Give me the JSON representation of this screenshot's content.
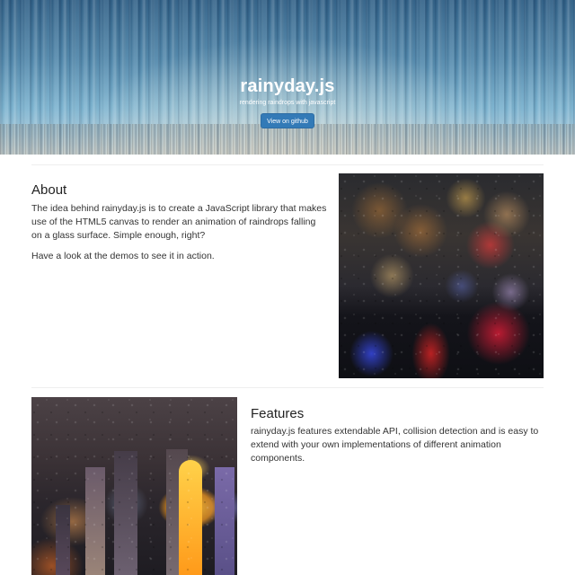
{
  "hero": {
    "title": "rainyday.js",
    "subtitle": "rendering raindrops with javascript",
    "button_label": "View on github"
  },
  "about": {
    "title": "About",
    "paragraphs": [
      "The idea behind rainyday.js is to create a JavaScript library that makes use of the HTML5 canvas to render an animation of raindrops falling on a glass surface. Simple enough, right?",
      "Have a look at the demos to see it in action."
    ]
  },
  "features": {
    "title": "Features",
    "paragraphs": [
      "rainyday.js features extendable API, collision detection and is easy to extend with your own implementations of different animation components."
    ]
  },
  "colors": {
    "button": "#337ab7",
    "text": "#333333",
    "divider": "#eeeeee"
  }
}
